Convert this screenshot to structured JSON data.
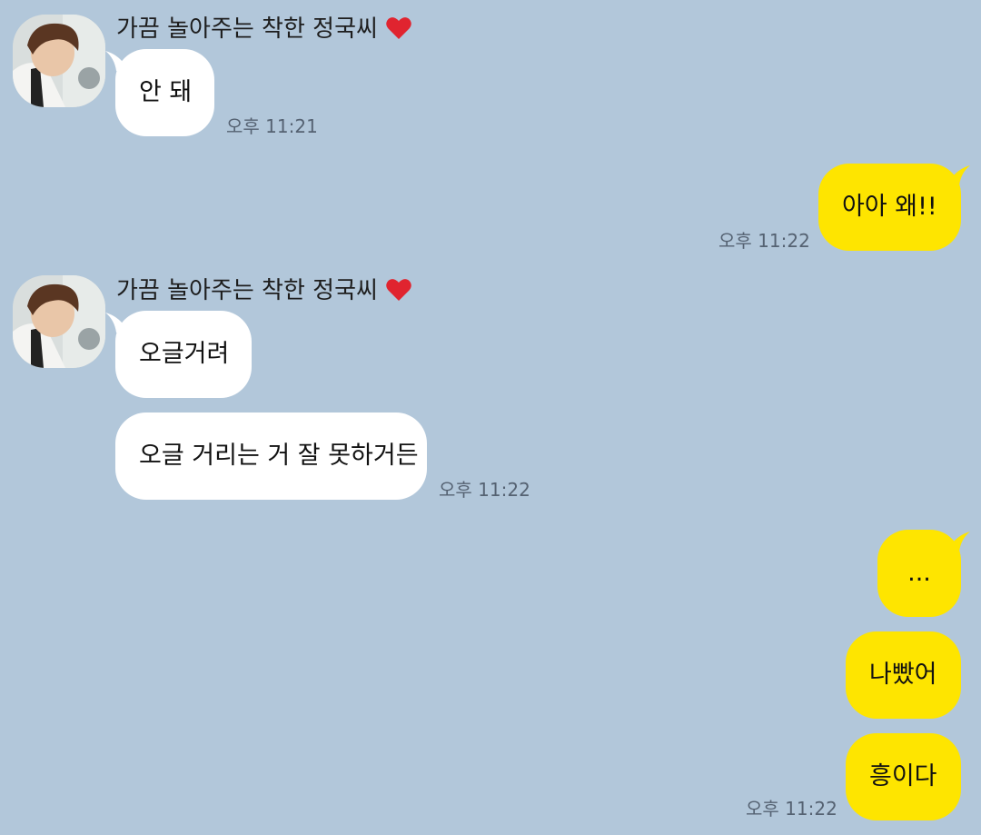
{
  "chat": {
    "contact_name": "가끔 놀아주는 착한 정국씨",
    "messages": [
      {
        "text": "안 돼",
        "time": "오후 11:21"
      },
      {
        "text": "아아 왜!!",
        "time": "오후 11:22"
      },
      {
        "text": "오글거려"
      },
      {
        "text": "오글 거리는 거 잘 못하거든",
        "time": "오후 11:22"
      },
      {
        "text": "..."
      },
      {
        "text": "나빴어"
      },
      {
        "text": "흥이다",
        "time": "오후 11:22"
      }
    ]
  },
  "colors": {
    "background": "#b2c7da",
    "incoming_bubble": "#ffffff",
    "outgoing_bubble": "#fee500",
    "timestamp": "#556272"
  },
  "icons": {
    "heart": "red-heart-icon"
  }
}
